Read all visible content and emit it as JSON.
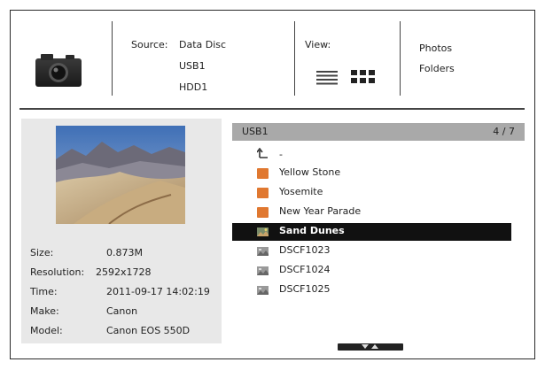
{
  "header": {
    "source_label": "Source:",
    "sources": [
      "Data Disc",
      "USB1",
      "HDD1"
    ],
    "view_label": "View:",
    "view_options": [
      "Photos",
      "Folders"
    ]
  },
  "preview": {
    "info": [
      {
        "label": "Size:",
        "value": "0.873M"
      },
      {
        "label": "Resolution:",
        "value": "2592x1728"
      },
      {
        "label": "Time:",
        "value": "2011-09-17 14:02:19"
      },
      {
        "label": "Make:",
        "value": "Canon"
      },
      {
        "label": "Model:",
        "value": "Canon EOS 550D"
      }
    ]
  },
  "browser": {
    "title": "USB1",
    "page": "4 / 7",
    "up_label": "-",
    "items": [
      {
        "label": "Yellow Stone",
        "icon": "folder-icon"
      },
      {
        "label": "Yosemite",
        "icon": "folder-icon"
      },
      {
        "label": "New Year Parade",
        "icon": "folder-icon"
      },
      {
        "label": "Sand Dunes",
        "icon": "photo-icon",
        "selected": true
      },
      {
        "label": "DSCF1023",
        "icon": "photo-icon"
      },
      {
        "label": "DSCF1024",
        "icon": "photo-icon"
      },
      {
        "label": "DSCF1025",
        "icon": "photo-icon"
      }
    ]
  },
  "colors": {
    "selection": "#111111",
    "header_bar": "#a9a9a9",
    "panel_bg": "#e8e8e8",
    "folder": "#e07830"
  }
}
